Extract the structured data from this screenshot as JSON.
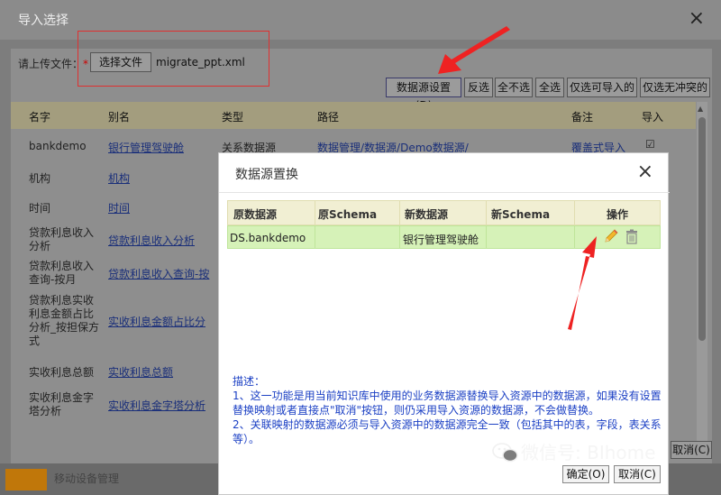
{
  "outer": {
    "title": "导入选择",
    "upload_label": "请上传文件：",
    "required_star": "*",
    "choose_file_label": "选择文件",
    "file_name": "migrate_ppt.xml",
    "toolbar": [
      "数据源设置(D)",
      "反选",
      "全不选",
      "全选",
      "仅选可导入的",
      "仅选无冲突的"
    ],
    "columns": [
      "名字",
      "别名",
      "类型",
      "路径",
      "备注",
      "导入"
    ],
    "rows": [
      {
        "name": "bankdemo",
        "alias": "银行管理驾驶舱",
        "type": "关系数据源",
        "path": "数据管理/数据源/Demo数据源/",
        "note": "覆盖式导入",
        "checked": true
      },
      {
        "name": "机构",
        "alias": "机构"
      },
      {
        "name": "时间",
        "alias": "时间"
      },
      {
        "name": "贷款利息收入分析",
        "alias": "贷款利息收入分析"
      },
      {
        "name": "贷款利息收入查询-按月",
        "alias": "贷款利息收入查询-按"
      },
      {
        "name": "贷款利息实收利息金额占比分析_按担保方式",
        "alias": "实收利息金额占比分"
      },
      {
        "name": "实收利息总额",
        "alias": "实收利息总额"
      },
      {
        "name": "实收利息金字塔分析",
        "alias": "实收利息金字塔分析"
      }
    ],
    "footer_partial": "取消(C)",
    "bottom_text": "移动设备管理"
  },
  "modal": {
    "title": "数据源置换",
    "columns": [
      "原数据源",
      "原Schema",
      "新数据源",
      "新Schema",
      "操作"
    ],
    "row": {
      "src": "DS.bankdemo",
      "src_schema": "",
      "dst": "银行管理驾驶舱",
      "dst_schema": ""
    },
    "desc_title": "描述：",
    "desc_1": "1、这一功能是用当前知识库中使用的业务数据源替换导入资源中的数据源，如果没有设置替换映射或者直接点\"取消\"按钮，则仍采用导入资源的数据源，不会做替换。",
    "desc_2": "2、关联映射的数据源必须与导入资源中的数据源完全一致（包括其中的表，字段，表关系等）。",
    "ok_label": "确定(O)",
    "cancel_label": "取消(C)"
  },
  "watermark": "微信号: BIhome",
  "colors": {
    "highlight_red": "#e03030",
    "row_green": "#d6f2b8",
    "header_yellow": "#f1efd3",
    "desc_blue": "#1a3fc4"
  }
}
